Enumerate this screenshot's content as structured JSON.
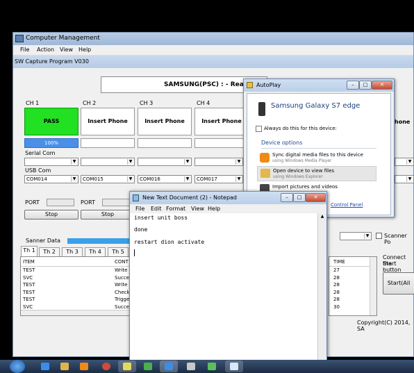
{
  "main_window": {
    "title": "Computer Management",
    "menu": [
      "File",
      "Action",
      "View",
      "Help"
    ],
    "app_title": "SW Capture Program V030",
    "banner": "SAMSUNG(PSC) : - Rea",
    "channels": [
      {
        "label": "CH 1",
        "status": "PASS",
        "progress": "100%"
      },
      {
        "label": "CH 2",
        "status": "Insert Phone",
        "progress": ""
      },
      {
        "label": "CH 3",
        "status": "Insert Phone",
        "progress": ""
      },
      {
        "label": "CH 4",
        "status": "Insert Phone",
        "progress": ""
      }
    ],
    "serial_label": "Serial Com",
    "usb_label": "USB Com",
    "usb_ports": [
      "COM014",
      "COM015",
      "COM016",
      "COM017"
    ],
    "port_label": "PORT",
    "stop_label": "Stop",
    "partial_status_right": "hone",
    "scanner_label": "Sanner Data",
    "scanner_checkbox_label": "Scanner Po",
    "tabs": [
      "Th 1",
      "Th 2",
      "Th 3",
      "Th 4",
      "Th 5"
    ],
    "table_headers": [
      "ITEM",
      "CONT",
      "TIME"
    ],
    "table_rows": [
      {
        "item": "TEST",
        "cont": "Write",
        "time": "27"
      },
      {
        "item": "SVC",
        "cont": "Succe",
        "time": "28"
      },
      {
        "item": "TEST",
        "cont": "Write",
        "time": "28"
      },
      {
        "item": "TEST",
        "cont": "Check",
        "time": "28"
      },
      {
        "item": "TEST",
        "cont": "Trigge",
        "time": "28"
      },
      {
        "item": "SVC",
        "cont": "Succe",
        "time": "30"
      }
    ],
    "connect_hint_1": "Connect the",
    "connect_hint_2": "Start button",
    "start_label": "Start(All",
    "copyright": "Copyright(C) 2014, SA"
  },
  "autoplay": {
    "title": "AutoPlay",
    "device": "Samsung Galaxy S7 edge",
    "always_label": "Always do this for this device:",
    "section": "Device options",
    "options": [
      {
        "title": "Sync digital media files to this device",
        "sub": "using Windows Media Player"
      },
      {
        "title": "Open device to view files",
        "sub": "using Windows Explorer"
      },
      {
        "title": "Import pictures and videos",
        "sub": ""
      }
    ],
    "control_panel_link": "Control Panel"
  },
  "notepad": {
    "title": "New Text Document (2) - Notepad",
    "menu": [
      "File",
      "Edit",
      "Format",
      "View",
      "Help"
    ],
    "lines": [
      "insert unit boss",
      "done",
      "restart dion activate"
    ]
  },
  "colors": {
    "pass": "#22e022",
    "progress": "#4a90e8",
    "title_bar": "#b9cfe9",
    "taskbar": "#1c2c44"
  }
}
